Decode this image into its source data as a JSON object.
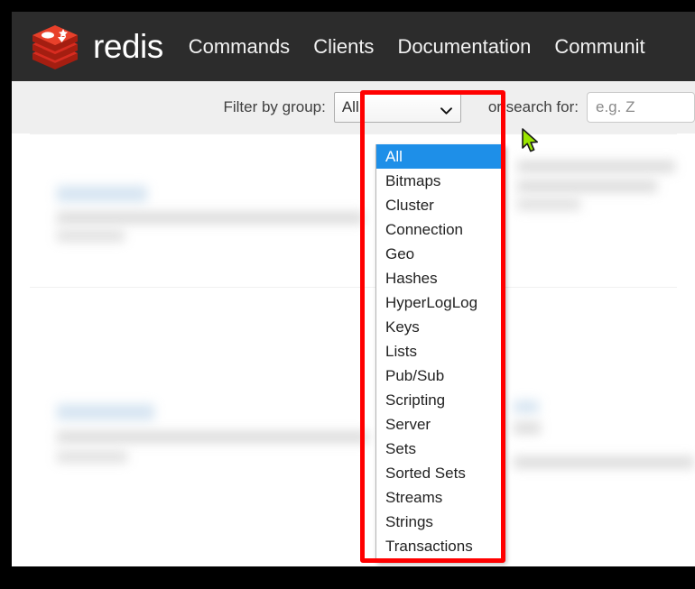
{
  "navbar": {
    "brand": "redis",
    "logo_icon": "redis-stack-logo-icon",
    "background_color": "#2c2c2c",
    "links": [
      {
        "label": "Commands"
      },
      {
        "label": "Clients"
      },
      {
        "label": "Documentation"
      },
      {
        "label": "Communit"
      }
    ]
  },
  "filter_bar": {
    "filter_label": "Filter by group:",
    "select_value": "All",
    "chevron_icon": "chevron-down-icon",
    "search_label": "or search for:",
    "search_placeholder": "e.g. Z"
  },
  "dropdown": {
    "expanded": true,
    "selected": "All",
    "highlight_color": "#1e8fe8",
    "options": [
      {
        "label": "All"
      },
      {
        "label": "Bitmaps"
      },
      {
        "label": "Cluster"
      },
      {
        "label": "Connection"
      },
      {
        "label": "Geo"
      },
      {
        "label": "Hashes"
      },
      {
        "label": "HyperLogLog"
      },
      {
        "label": "Keys"
      },
      {
        "label": "Lists"
      },
      {
        "label": "Pub/Sub"
      },
      {
        "label": "Scripting"
      },
      {
        "label": "Server"
      },
      {
        "label": "Sets"
      },
      {
        "label": "Sorted Sets"
      },
      {
        "label": "Streams"
      },
      {
        "label": "Strings"
      },
      {
        "label": "Transactions"
      }
    ]
  },
  "annotation": {
    "highlight_box_color": "#ff0000",
    "cursor_icon": "arrow-pointer-cursor-icon"
  },
  "page_content": {
    "blurred": true,
    "description": "blurred redis command list entries"
  }
}
